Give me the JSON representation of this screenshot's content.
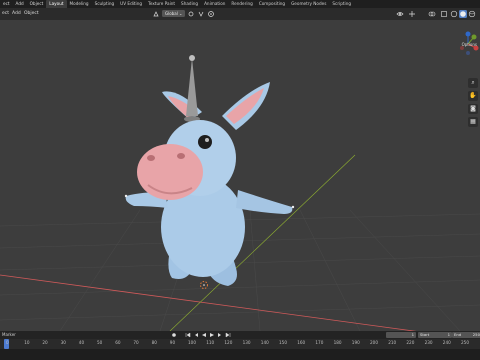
{
  "topbar": {
    "menus": [
      "ect",
      "Add",
      "Object"
    ],
    "tabs": [
      "Layout",
      "Modeling",
      "Sculpting",
      "UV Editing",
      "Texture Paint",
      "Shading",
      "Animation",
      "Rendering",
      "Compositing",
      "Geometry Nodes",
      "Scripting"
    ],
    "active_tab": "Layout"
  },
  "header": {
    "menus": [
      "ect",
      "Add",
      "Object"
    ],
    "transform_orientation": "Global",
    "options_label": "Options"
  },
  "timeline": {
    "marker_label": "Marker",
    "current_frame": "1",
    "start_label": "Start",
    "start_value": "1",
    "end_label": "End",
    "end_value": "250"
  },
  "ruler_ticks": [
    "0",
    "10",
    "20",
    "30",
    "40",
    "50",
    "60",
    "70",
    "80",
    "90",
    "100",
    "110",
    "120",
    "130",
    "140",
    "150",
    "160",
    "170",
    "180",
    "190",
    "200",
    "210",
    "220",
    "230",
    "240",
    "250"
  ],
  "colors": {
    "accent": "#5680c2",
    "body_blue": "#a9c9e6",
    "snout_pink": "#e8a4a8",
    "axis_x": "#d15a5a",
    "axis_y": "#8fb030",
    "playhead": "#4d7bd1"
  },
  "icons": [
    "select-icon",
    "cursor-icon",
    "move-icon",
    "view-icon",
    "lock-icon",
    "hand-icon",
    "camera-icon",
    "grid-icon"
  ]
}
